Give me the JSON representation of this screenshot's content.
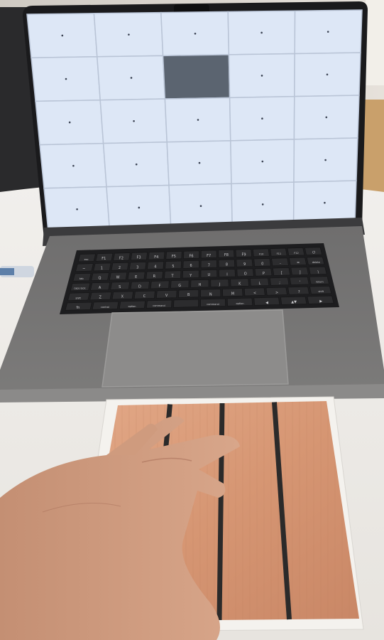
{
  "screen": {
    "grid_rows": 5,
    "grid_cols": 5,
    "highlighted_cell": {
      "row": 1,
      "col": 2
    },
    "cell_color": "#dde7f6",
    "highlight_color": "#5b6470",
    "line_color": "#b9c4d6",
    "dot_color": "#3a4252"
  },
  "keyboard": {
    "rows": [
      [
        "esc",
        "F1",
        "F2",
        "F3",
        "F4",
        "F5",
        "F6",
        "F7",
        "F8",
        "F9",
        "F10",
        "F11",
        "F12",
        "⏻"
      ],
      [
        "~",
        "1",
        "2",
        "3",
        "4",
        "5",
        "6",
        "7",
        "8",
        "9",
        "0",
        "-",
        "=",
        "delete"
      ],
      [
        "tab",
        "Q",
        "W",
        "E",
        "R",
        "T",
        "Y",
        "U",
        "I",
        "O",
        "P",
        "[",
        "]",
        "\\"
      ],
      [
        "caps lock",
        "A",
        "S",
        "D",
        "F",
        "G",
        "H",
        "J",
        "K",
        "L",
        ";",
        "'",
        "return"
      ],
      [
        "shift",
        "Z",
        "X",
        "C",
        "V",
        "B",
        "N",
        "M",
        "<",
        ">",
        "?",
        "shift"
      ],
      [
        "fn",
        "control",
        "option",
        "command",
        "",
        "command",
        "option",
        "◀",
        "▲▼",
        "▶"
      ]
    ]
  },
  "touch_pad": {
    "strip_count": 4,
    "copper_color": "#d99a78",
    "divider_color": "#2b2a2a"
  }
}
